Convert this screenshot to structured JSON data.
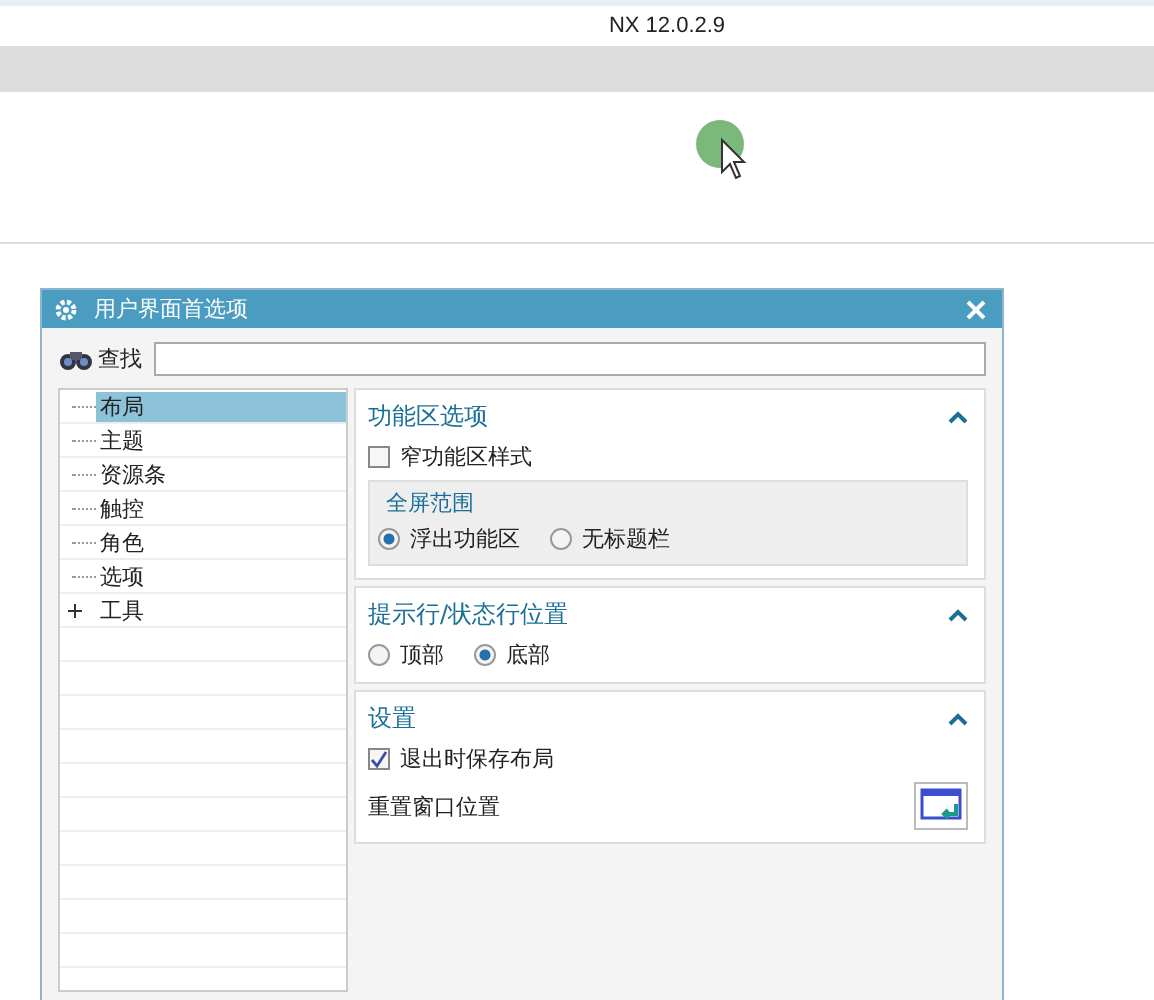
{
  "app_title": "NX 12.0.2.9",
  "dialog": {
    "title": "用户界面首选项",
    "search": {
      "label": "查找"
    },
    "tree": [
      {
        "label": "布局",
        "selected": true
      },
      {
        "label": "主题",
        "selected": false
      },
      {
        "label": "资源条",
        "selected": false
      },
      {
        "label": "触控",
        "selected": false
      },
      {
        "label": "角色",
        "selected": false
      },
      {
        "label": "选项",
        "selected": false
      },
      {
        "label": "工具",
        "selected": false,
        "expanded": false
      }
    ],
    "sections": [
      {
        "title": "功能区选项",
        "expanded": true,
        "items": [
          {
            "kind": "checkbox",
            "label": "窄功能区样式",
            "checked": false
          },
          {
            "kind": "group",
            "title": "全屏范围",
            "options": [
              {
                "label": "浮出功能区",
                "selected": true
              },
              {
                "label": "无标题栏",
                "selected": false
              }
            ]
          }
        ]
      },
      {
        "title": "提示行/状态行位置",
        "expanded": true,
        "items": [
          {
            "kind": "radios",
            "options": [
              {
                "label": "顶部",
                "selected": false
              },
              {
                "label": "底部",
                "selected": true
              }
            ]
          }
        ]
      },
      {
        "title": "设置",
        "expanded": true,
        "items": [
          {
            "kind": "checkbox",
            "label": "退出时保存布局",
            "checked": true
          },
          {
            "kind": "action",
            "label": "重置窗口位置"
          }
        ]
      }
    ]
  }
}
